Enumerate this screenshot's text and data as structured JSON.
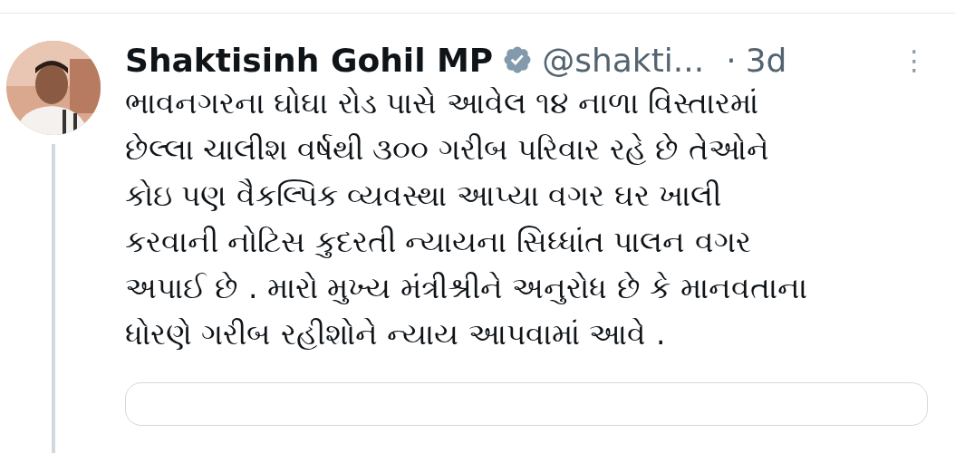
{
  "tweet": {
    "name": "Shaktisinh Gohil MP",
    "verified": true,
    "handle": "@shakti...",
    "separator": "·",
    "time": "3d",
    "more": "⋮",
    "body_lines": [
      "ભાવનગરના ઘોઘા રોડ પાસે આવેલ ૧૪ નાળા વિસ્તારમાં",
      "છેલ્લા ચાલીશ વર્ષથી ૩૦૦ ગરીબ પરિવાર રહે છે તેઓને",
      "કોઇ પણ વૈકલ્પિક વ્યવસ્થા આપ્યા વગર ઘર ખાલી",
      "કરવાની નોટિસ કુદરતી ન્યાયના સિધ્ધાંત પાલન વગર",
      "અપાઈ છે . મારો મુખ્ય મંત્રીશ્રીને અનુરોધ છે કે માનવતાના",
      "ધોરણે ગરીબ રહીશોને ન્યાય આપવામાં આવે ."
    ]
  }
}
